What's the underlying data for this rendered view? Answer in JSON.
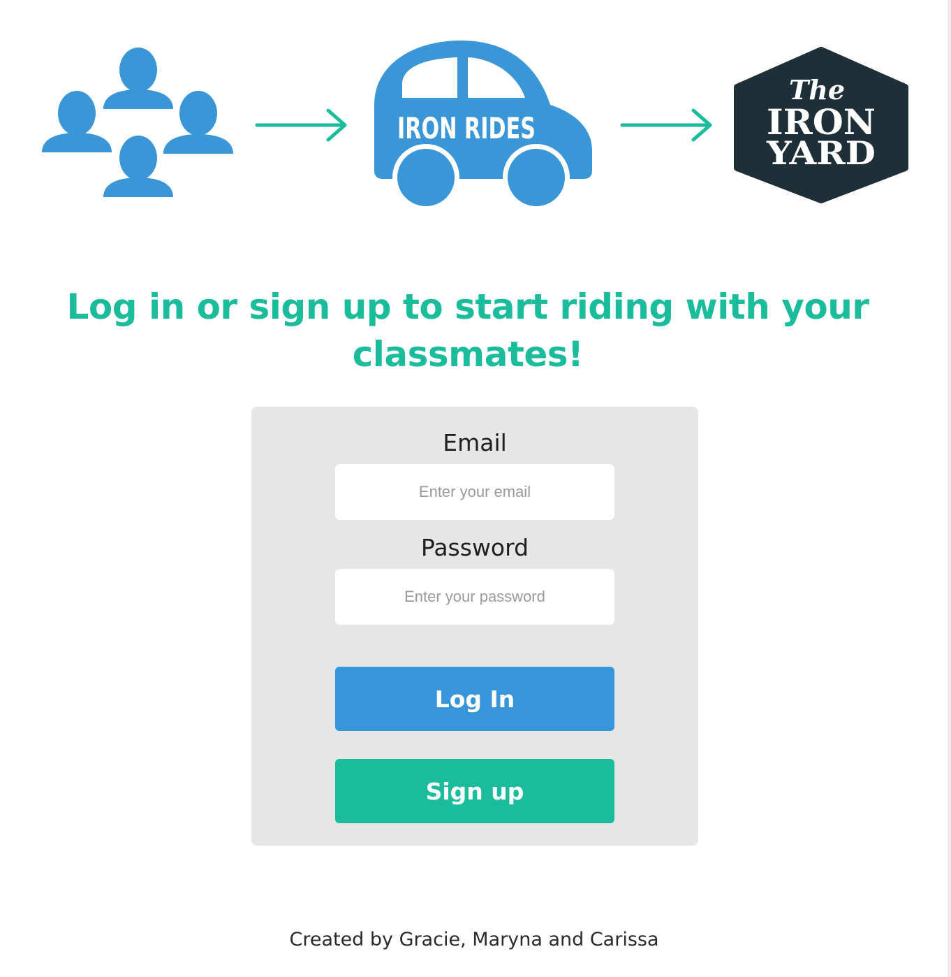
{
  "colors": {
    "accent_green": "#1bbc9b",
    "arrow_green": "#1abc9c",
    "brand_blue": "#3a96d6",
    "iron_yard_dark": "#1f2f38",
    "login_button": "#3796da",
    "signup_button": "#1bbc9b",
    "card_background": "#e6e6e6"
  },
  "hero": {
    "icons": [
      "people-group-icon",
      "arrow-right-icon",
      "car-icon",
      "arrow-right-icon",
      "hexagon-logo-icon"
    ],
    "car_text": "IRON RIDES",
    "logo_the": "The",
    "logo_iron": "IRON",
    "logo_yard": "YARD"
  },
  "headline": {
    "line1": "Log in or sign up to start riding with your",
    "line2": "classmates!"
  },
  "form": {
    "email_label": "Email",
    "email_placeholder": "Enter your email",
    "email_value": "",
    "password_label": "Password",
    "password_placeholder": "Enter your password",
    "password_value": "",
    "login_label": "Log In",
    "signup_label": "Sign up"
  },
  "footer": {
    "credit": "Created by Gracie, Maryna and Carissa"
  }
}
